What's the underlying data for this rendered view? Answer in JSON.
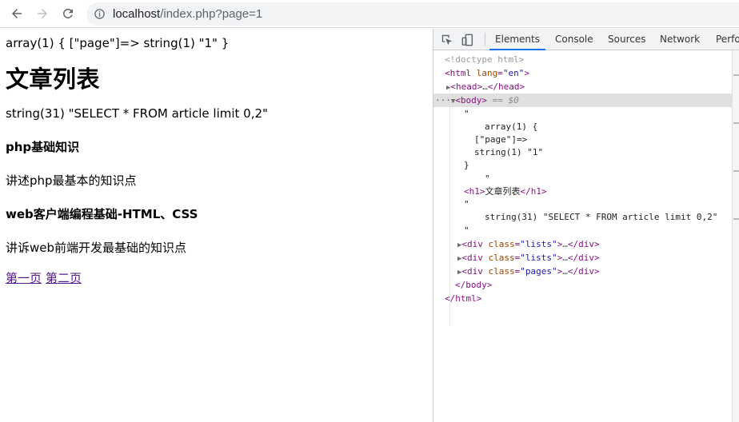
{
  "browser": {
    "url_host": "localhost",
    "url_rest": "/index.php?page=1",
    "icons": [
      "back-icon",
      "forward-icon",
      "reload-icon",
      "info-icon"
    ]
  },
  "page": {
    "dump": "array(1) { [\"page\"]=> string(1) \"1\" }",
    "title": "文章列表",
    "sql": "string(31) \"SELECT * FROM article limit 0,2\"",
    "articles": [
      {
        "title": "php基础知识",
        "desc": "讲述php最基本的知识点"
      },
      {
        "title": "web客户端编程基础-HTML、CSS",
        "desc": "讲诉web前端开发最基础的知识点"
      }
    ],
    "pagination": [
      "第一页",
      "第二页"
    ]
  },
  "devtools": {
    "tabs": [
      "Elements",
      "Console",
      "Sources",
      "Network",
      "Perfor"
    ],
    "active_tab": "Elements",
    "dom": {
      "doctype": "<!doctype html>",
      "html_open_tag": "html",
      "html_attr_name": "lang",
      "html_attr_value": "\"en\"",
      "head": "head",
      "head_close": "/head",
      "body": "body",
      "body_marker": "== $0",
      "text_quote": "\"",
      "dump_line1": "array(1) {",
      "dump_line2": "[\"page\"]=>",
      "dump_line3": "string(1) \"1\"",
      "dump_line4": "}",
      "h1_tag": "h1",
      "h1_text": "文章列表",
      "h1_close": "/h1",
      "sql_line": "string(31) \"SELECT * FROM article limit 0,2\"",
      "div_tag": "div",
      "div_close": "/div",
      "class_attr": "class",
      "div_classes": [
        "\"lists\"",
        "\"lists\"",
        "\"pages\""
      ],
      "body_close": "/body",
      "html_close": "/html",
      "ellipsis": "…"
    }
  }
}
